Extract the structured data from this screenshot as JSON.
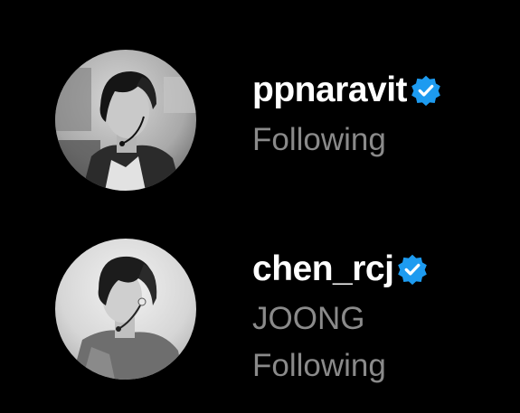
{
  "accounts": [
    {
      "username": "ppnaravit",
      "verified": true,
      "subtitle": null,
      "status": "Following",
      "avatar": "profile-photo"
    },
    {
      "username": "chen_rcj",
      "verified": true,
      "subtitle": "JOONG",
      "status": "Following",
      "avatar": "profile-photo"
    }
  ],
  "colors": {
    "background": "#000000",
    "username": "#ffffff",
    "secondary_text": "#8a8a8a",
    "verified_badge": "#1d9bf0"
  },
  "icons": {
    "verified": "verified-badge-icon"
  }
}
